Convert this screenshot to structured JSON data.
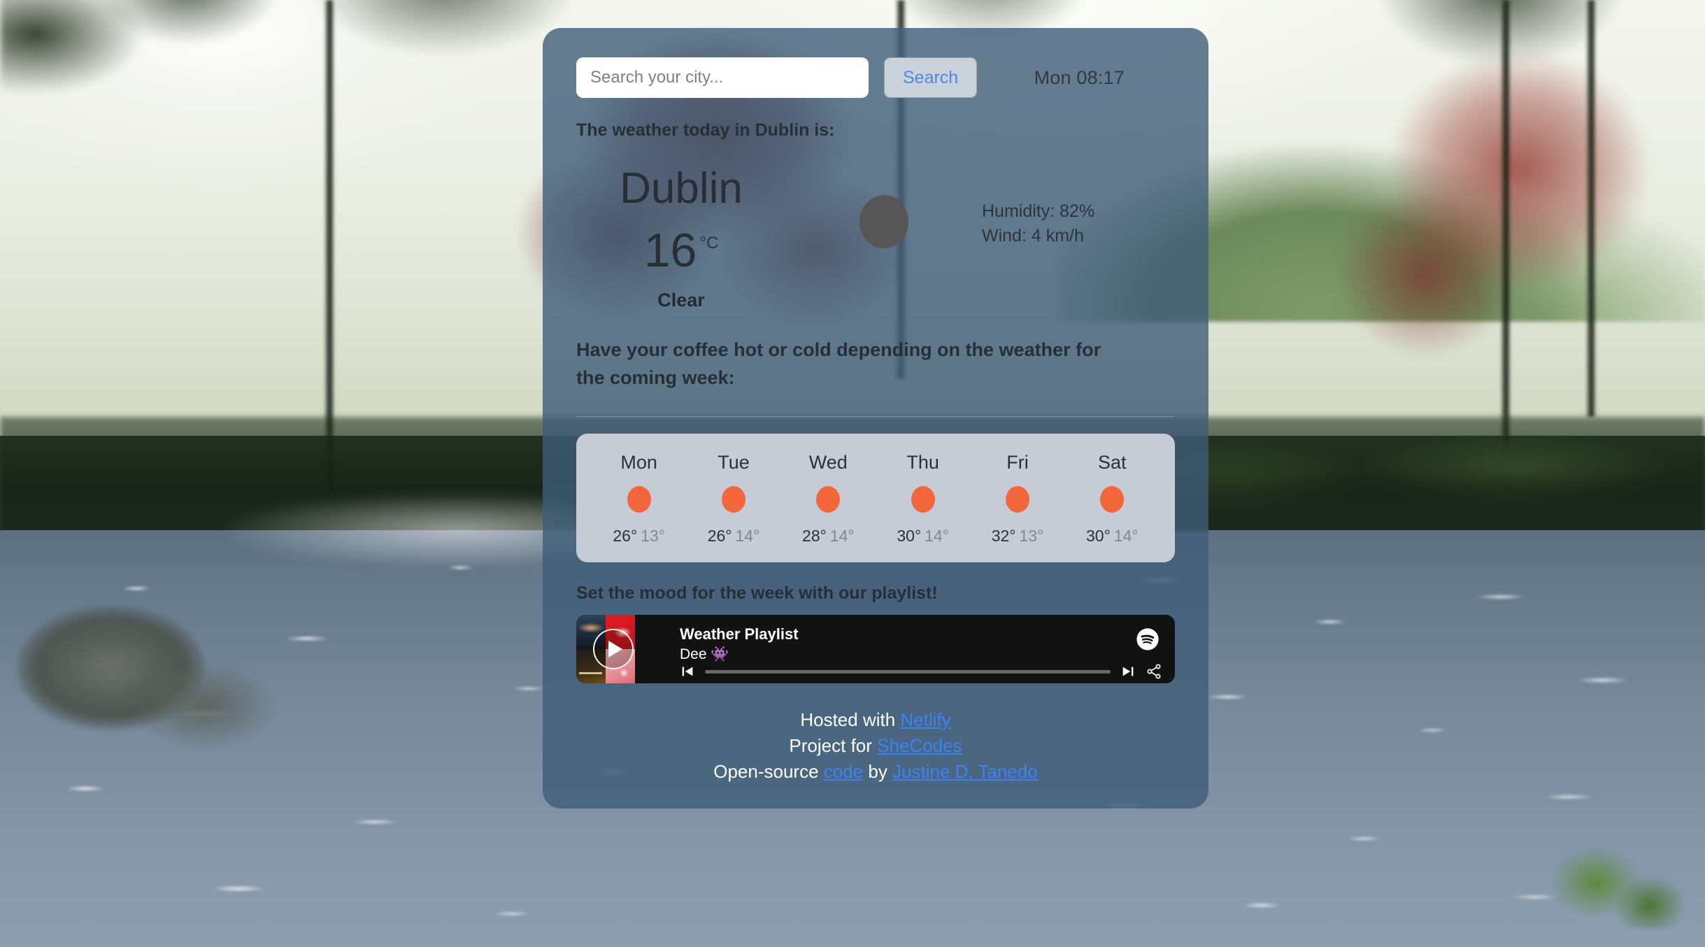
{
  "background": {
    "scene_description": "river-landscape-photo"
  },
  "search": {
    "placeholder": "Search your city...",
    "value": "",
    "button_label": "Search"
  },
  "clock": "Mon 08:17",
  "intro_text": "The weather today in Dublin is:",
  "current": {
    "city": "Dublin",
    "temperature": "16",
    "unit": "°C",
    "condition": "Clear",
    "icon": "weather-icon-placeholder",
    "humidity": "Humidity: 82%",
    "wind": "Wind: 4 km/h"
  },
  "coffee_text": "Have your coffee hot or cold depending on the weather for the coming week:",
  "forecast": [
    {
      "day": "Mon",
      "icon": "sun-icon",
      "high": "26°",
      "low": "13°"
    },
    {
      "day": "Tue",
      "icon": "sun-icon",
      "high": "26°",
      "low": "14°"
    },
    {
      "day": "Wed",
      "icon": "sun-icon",
      "high": "28°",
      "low": "14°"
    },
    {
      "day": "Thu",
      "icon": "sun-icon",
      "high": "30°",
      "low": "14°"
    },
    {
      "day": "Fri",
      "icon": "sun-icon",
      "high": "32°",
      "low": "13°"
    },
    {
      "day": "Sat",
      "icon": "sun-icon",
      "high": "30°",
      "low": "14°"
    }
  ],
  "playlist": {
    "heading": "Set the mood for the week with our playlist!",
    "track_title": "Weather Playlist",
    "artist": "Dee 👾",
    "provider_icon": "spotify-icon",
    "play_icon": "play-icon",
    "prev_icon": "previous-track-icon",
    "next_icon": "next-track-icon",
    "share_icon": "share-icon",
    "progress_percent": 0
  },
  "footer": {
    "line1_prefix": "Hosted with ",
    "line1_link": "Netlify",
    "line2_prefix": "Project for ",
    "line2_link": "SheCodes",
    "line3_prefix": "Open-source ",
    "line3_link1": "code",
    "line3_mid": " by ",
    "line3_link2": "Justine D. Tanedo"
  },
  "colors": {
    "card_bg": "#3f5c78",
    "forecast_bg": "#c5ccd5",
    "accent_sun": "#f4663c",
    "link": "#3b82f6",
    "search_btn_text": "#4f86e8"
  }
}
